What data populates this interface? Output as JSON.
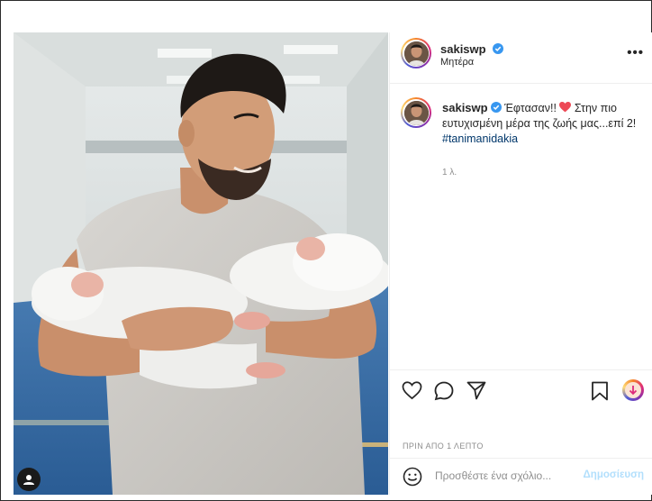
{
  "header": {
    "username": "sakiswp",
    "verified": true,
    "location": "Μητέρα",
    "more_icon": "more-horizontal-icon",
    "more_label": "•••"
  },
  "caption": {
    "username": "sakiswp",
    "text_before": "Έφτασαν!! ",
    "heart_emoji": "❤️",
    "text_after": " Στην πιο ευτυχισμένη μέρα της ζωής μας...επί 2!",
    "hashtag": "#tanimanidakia",
    "time_ago": "1 λ."
  },
  "actions": {
    "icons": [
      "heart-icon",
      "comment-icon",
      "share-icon",
      "save-icon",
      "igtv-icon"
    ]
  },
  "timestamp": "ΠΡΙΝ ΑΠΟ 1 ΛΕΠΤΟ",
  "comment": {
    "emoji_icon": "smiley-icon",
    "placeholder": "Προσθέστε ένα σχόλιο...",
    "post_label": "Δημοσίευση"
  },
  "colors": {
    "verified_blue": "#3897f0",
    "hashtag_blue": "#00376b",
    "heart_red": "#ed4956",
    "post_disabled": "#b2dffc"
  }
}
